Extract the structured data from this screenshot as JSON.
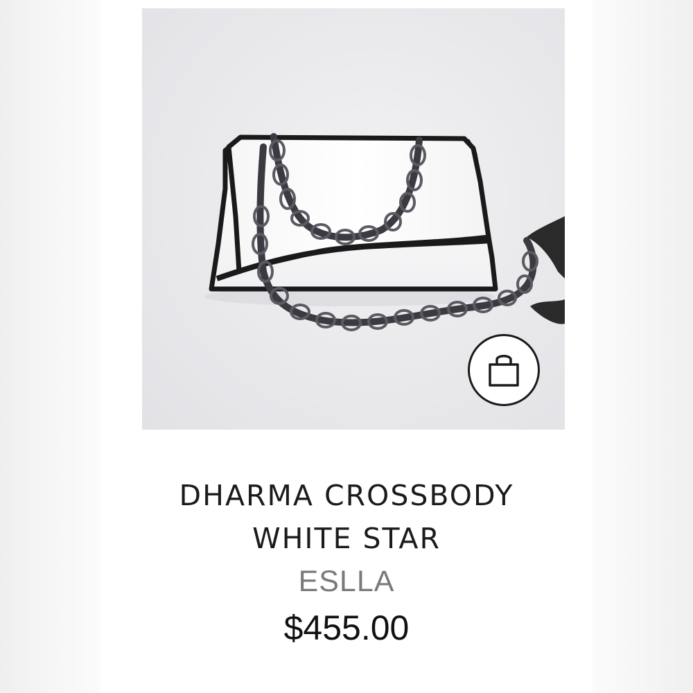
{
  "product": {
    "image_alt": "White crossbody bag with black trim and gunmetal chain strap",
    "title_line1": "DHARMA CROSSBODY",
    "title_line2": "WHITE STAR",
    "brand": "ESLLA",
    "price": "$455.00",
    "add_to_bag_icon": "shopping-bag-icon"
  },
  "colors": {
    "title": "#1b1b1b",
    "brand": "#7a7a7a",
    "price": "#111111",
    "image_background": "#e9e9ec",
    "bag_body": "#ffffff",
    "bag_trim": "#1a1a1a",
    "chain": "#3a3a40"
  }
}
